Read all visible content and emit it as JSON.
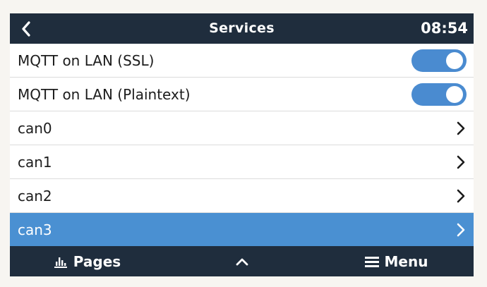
{
  "header": {
    "title": "Services",
    "clock": "08:54",
    "back_icon": "chevron-left-icon"
  },
  "items": [
    {
      "label": "MQTT on LAN (SSL)",
      "type": "toggle",
      "enabled": true
    },
    {
      "label": "MQTT on LAN (Plaintext)",
      "type": "toggle",
      "enabled": true
    },
    {
      "label": "can0",
      "type": "submenu"
    },
    {
      "label": "can1",
      "type": "submenu"
    },
    {
      "label": "can2",
      "type": "submenu"
    },
    {
      "label": "can3",
      "type": "submenu",
      "selected": true
    }
  ],
  "footer": {
    "pages_label": "Pages",
    "pages_icon": "bar-chart-icon",
    "up_icon": "chevron-up-icon",
    "menu_label": "Menu",
    "menu_icon": "hamburger-icon"
  },
  "colors": {
    "header_bg": "#1f2d3d",
    "accent": "#4a90d2",
    "toggle_on": "#4a8bd0",
    "page_bg": "#f7f5f1"
  }
}
